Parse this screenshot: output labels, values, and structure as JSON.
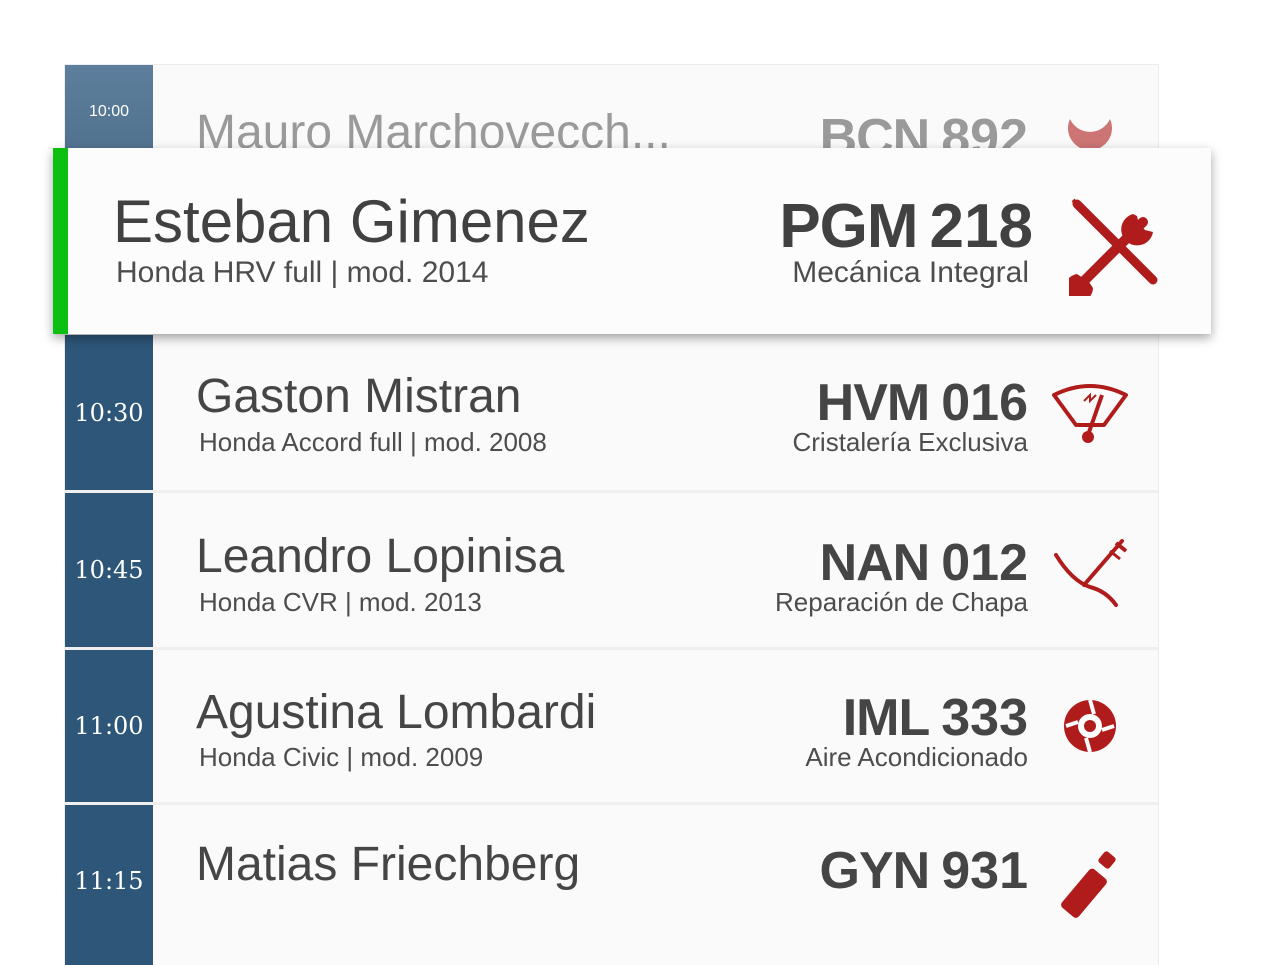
{
  "rows": [
    {
      "time": "10:00",
      "name": "Mauro Marchovecch...",
      "plate_letters": "BCN",
      "plate_number": "892",
      "icon": "wrench-icon"
    },
    {
      "time": "10:30",
      "name": "Gaston Mistran",
      "model": "Honda Accord full  |  mod.  2008",
      "plate_letters": "HVM",
      "plate_number": "016",
      "service": "Cristalería Exclusiva",
      "icon": "windshield-icon"
    },
    {
      "time": "10:45",
      "name": "Leandro Lopinisa",
      "model": "Honda CVR  |  mod. 2013",
      "plate_letters": "NAN",
      "plate_number": "012",
      "service": "Reparación de Chapa",
      "icon": "dent-repair-icon"
    },
    {
      "time": "11:00",
      "name": "Agustina Lombardi",
      "model": "Honda Civic   |  mod. 2009",
      "plate_letters": "IML",
      "plate_number": "333",
      "service": "Aire Acondicionado",
      "icon": "fan-icon"
    },
    {
      "time": "11:15",
      "name": "Matias Friechberg",
      "plate_letters": "GYN",
      "plate_number": "931",
      "icon": "paint-spray-icon"
    }
  ],
  "active": {
    "name": "Esteban Gimenez",
    "model": "Honda HRV full  |  mod. 2014",
    "plate_letters": "PGM",
    "plate_number": "218",
    "service": "Mecánica Integral",
    "icon": "tools-icon",
    "accent_color": "#0cbf10"
  },
  "colors": {
    "time_column": "#2d5678",
    "icon": "#b01c1c"
  }
}
